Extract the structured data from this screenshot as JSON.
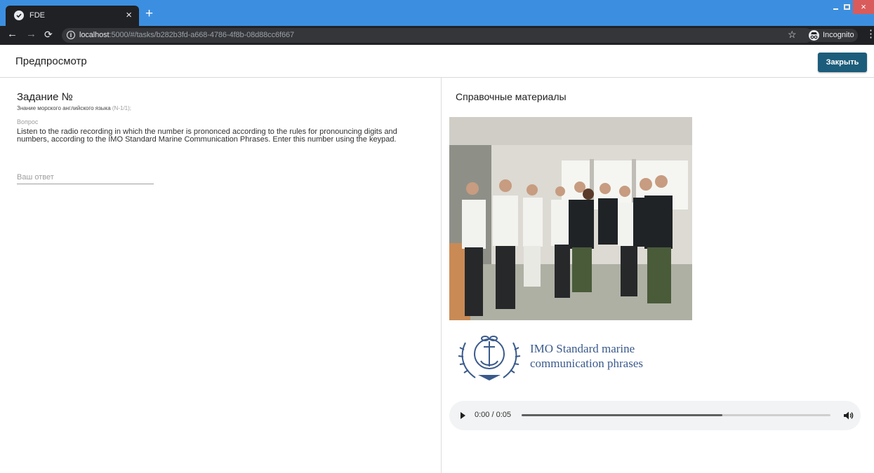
{
  "browser": {
    "tab_title": "FDE",
    "tab_close": "×",
    "new_tab": "+",
    "url_scheme_host": "localhost",
    "url_rest": ":5000/#/tasks/b282b3fd-a668-4786-4f8b-08d88cc6f667",
    "incognito_label": "Incognito",
    "window_close": "×",
    "icons": [
      "check-circle-icon",
      "back-arrow-icon",
      "forward-arrow-icon",
      "reload-icon",
      "info-icon",
      "star-icon",
      "incognito-icon",
      "menu-dots-icon"
    ],
    "colors": {
      "tabbar": "#3c8fe0",
      "toolbar": "#202124",
      "close": "#d95b5b"
    }
  },
  "app": {
    "title": "Предпросмотр",
    "close_label": "Закрыть",
    "accent": "#1c5d7b"
  },
  "task": {
    "title": "Задание №",
    "subject": "Знание морского английского языка",
    "subject_code": "(N-1/1);",
    "question_label": "Вопрос",
    "question_text": "Listen to the radio recording in which the number is prononced according to the rules for pronouncing digits and numbers, according to the IMO Standard Marine Communication Phrases. Enter this number using the keypad.",
    "answer_placeholder": "Ваш ответ",
    "answer_value": ""
  },
  "references": {
    "title": "Справочные материалы",
    "imo_caption_line1": "IMO Standard marine",
    "imo_caption_line2": "communication phrases",
    "audio": {
      "time": "0:00 / 0:05",
      "progress": 0.65
    }
  }
}
